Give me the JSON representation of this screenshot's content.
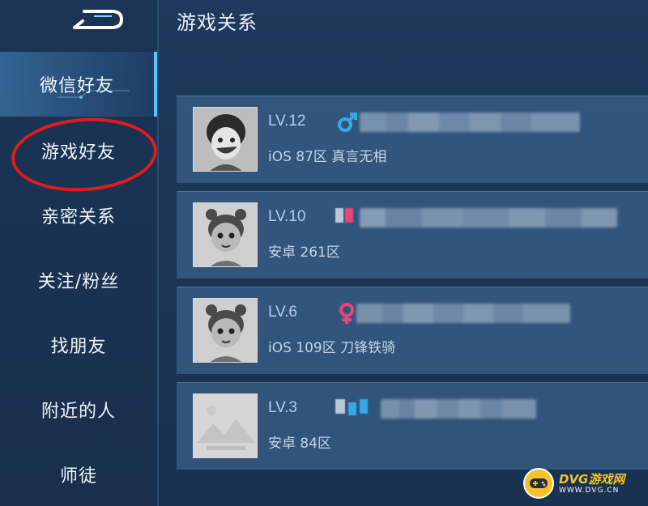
{
  "header": {
    "title": "游戏关系"
  },
  "sidebar": {
    "back_icon": "back-arrow-icon",
    "items": [
      {
        "label": "微信好友",
        "active": true
      },
      {
        "label": "游戏好友",
        "active": false,
        "circled": true
      },
      {
        "label": "亲密关系",
        "active": false
      },
      {
        "label": "关注/粉丝",
        "active": false
      },
      {
        "label": "找朋友",
        "active": false
      },
      {
        "label": "附近的人",
        "active": false
      },
      {
        "label": "师徒",
        "active": false
      }
    ]
  },
  "friends": [
    {
      "level": "LV.12",
      "gender": "male",
      "server": "iOS 87区 真言无相",
      "avatar": "cartoon-boy-avatar"
    },
    {
      "level": "LV.10",
      "gender": "female",
      "server": "安卓 261区",
      "avatar": "cartoon-girl-avatar"
    },
    {
      "level": "LV.6",
      "gender": "female",
      "server": "iOS 109区 刀锋铁骑",
      "avatar": "cartoon-girl-avatar"
    },
    {
      "level": "LV.3",
      "gender": "unknown",
      "server": "安卓 84区",
      "avatar": "default-placeholder-avatar"
    }
  ],
  "colors": {
    "male": "#35a8e8",
    "female": "#e8457a",
    "annotation_circle": "#e21c1c",
    "watermark_brand": "#f5c22a"
  },
  "watermark": {
    "main": "DVG游戏网",
    "sub": "WWW.DVG.CN"
  }
}
